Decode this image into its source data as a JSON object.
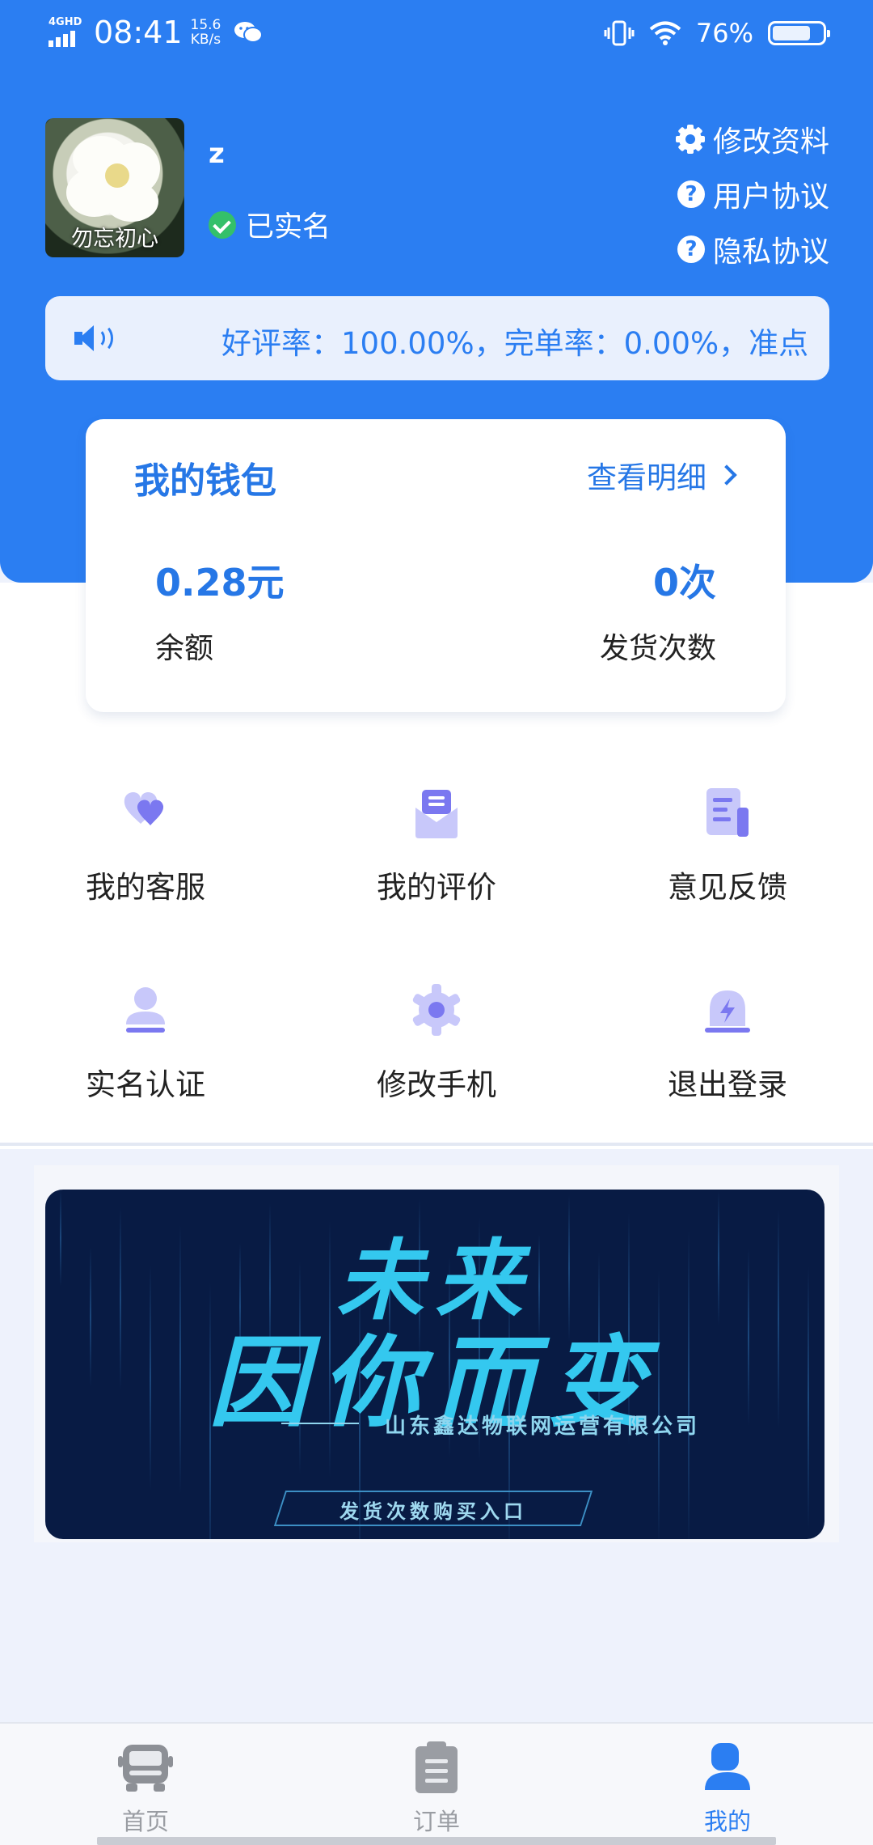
{
  "status_bar": {
    "network": "4GHD",
    "time": "08:41",
    "speed_value": "15.6",
    "speed_unit": "KB/s",
    "battery": "76%",
    "battery_level": 0.76,
    "icons": [
      "signal-icon",
      "wechat-icon",
      "vibrate-icon",
      "wifi-icon",
      "battery-icon"
    ]
  },
  "profile": {
    "avatar_caption": "勿忘初心",
    "username": "z",
    "verified_text": "已实名",
    "links": [
      "修改资料",
      "用户协议",
      "隐私协议"
    ]
  },
  "notice": {
    "text": "好评率：100.00%，完单率：0.00%，准点"
  },
  "wallet": {
    "title": "我的钱包",
    "detail_link": "查看明细",
    "balance_value": "0.28元",
    "balance_label": "余额",
    "shipments_value": "0次",
    "shipments_label": "发货次数"
  },
  "menu": {
    "items": [
      {
        "label": "我的客服",
        "icon": "heart-icon"
      },
      {
        "label": "我的评价",
        "icon": "envelope-icon"
      },
      {
        "label": "意见反馈",
        "icon": "document-icon"
      },
      {
        "label": "实名认证",
        "icon": "person-icon"
      },
      {
        "label": "修改手机",
        "icon": "gear-icon"
      },
      {
        "label": "退出登录",
        "icon": "alarm-bell-icon"
      }
    ]
  },
  "banner": {
    "line1": "未来",
    "line2": "因你而变",
    "company": "山东鑫达物联网运营有限公司",
    "button": "发货次数购买入口"
  },
  "bottom_nav": {
    "items": [
      {
        "label": "首页",
        "icon": "truck-icon",
        "active": false
      },
      {
        "label": "订单",
        "icon": "clipboard-icon",
        "active": false
      },
      {
        "label": "我的",
        "icon": "user-icon",
        "active": true
      }
    ]
  },
  "colors": {
    "primary": "#2b7ef2",
    "icon_purple": "#7b78f0",
    "icon_light": "#c8c8fa",
    "verified_green": "#34c06a",
    "banner_bg": "#081b44",
    "banner_text": "#34c8ef"
  }
}
